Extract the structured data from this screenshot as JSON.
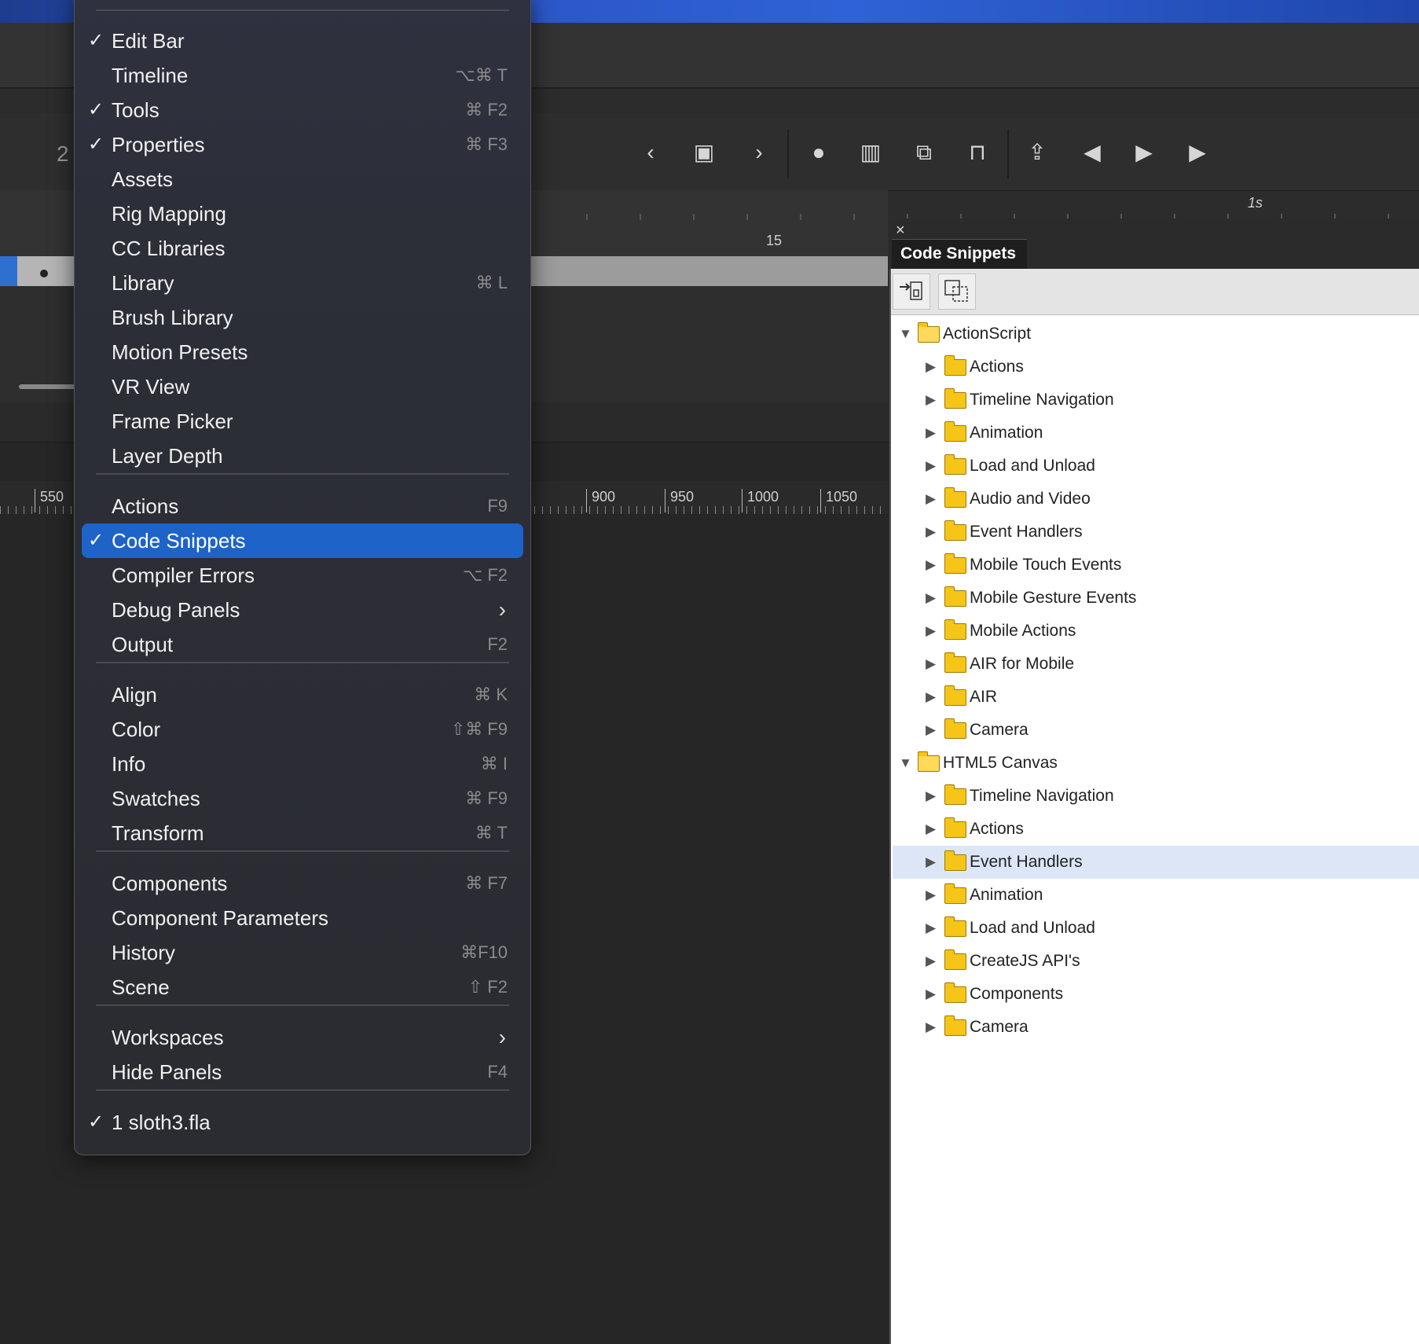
{
  "timeline": {
    "frame_15": "15",
    "time_1s": "1s",
    "layer_num": "2"
  },
  "stage_ruler": [
    "550",
    "900",
    "950",
    "1000",
    "1050"
  ],
  "menu": {
    "items": [
      {
        "label": "Edit Bar",
        "checked": "✓",
        "shortcut": ""
      },
      {
        "label": "Timeline",
        "checked": "",
        "shortcut": "⌥⌘ T"
      },
      {
        "label": "Tools",
        "checked": "✓",
        "shortcut": "⌘ F2"
      },
      {
        "label": "Properties",
        "checked": "✓",
        "shortcut": "⌘ F3"
      },
      {
        "label": "Assets",
        "checked": "",
        "shortcut": ""
      },
      {
        "label": "Rig Mapping",
        "checked": "",
        "shortcut": ""
      },
      {
        "label": "CC Libraries",
        "checked": "",
        "shortcut": ""
      },
      {
        "label": "Library",
        "checked": "",
        "shortcut": "⌘ L"
      },
      {
        "label": "Brush Library",
        "checked": "",
        "shortcut": ""
      },
      {
        "label": "Motion Presets",
        "checked": "",
        "shortcut": ""
      },
      {
        "label": "VR View",
        "checked": "",
        "shortcut": ""
      },
      {
        "label": "Frame Picker",
        "checked": "",
        "shortcut": ""
      },
      {
        "label": "Layer Depth",
        "checked": "",
        "shortcut": ""
      },
      {
        "label": "Actions",
        "checked": "",
        "shortcut": "F9"
      },
      {
        "label": "Code Snippets",
        "checked": "✓",
        "shortcut": ""
      },
      {
        "label": "Compiler Errors",
        "checked": "",
        "shortcut": "⌥ F2"
      },
      {
        "label": "Debug Panels",
        "checked": "",
        "shortcut": ""
      },
      {
        "label": "Output",
        "checked": "",
        "shortcut": "F2"
      },
      {
        "label": "Align",
        "checked": "",
        "shortcut": "⌘ K"
      },
      {
        "label": "Color",
        "checked": "",
        "shortcut": "⇧⌘ F9"
      },
      {
        "label": "Info",
        "checked": "",
        "shortcut": "⌘ I"
      },
      {
        "label": "Swatches",
        "checked": "",
        "shortcut": "⌘ F9"
      },
      {
        "label": "Transform",
        "checked": "",
        "shortcut": "⌘ T"
      },
      {
        "label": "Components",
        "checked": "",
        "shortcut": "⌘ F7"
      },
      {
        "label": "Component Parameters",
        "checked": "",
        "shortcut": ""
      },
      {
        "label": "History",
        "checked": "",
        "shortcut": "⌘F10"
      },
      {
        "label": "Scene",
        "checked": "",
        "shortcut": "⇧ F2"
      },
      {
        "label": "Workspaces",
        "checked": "",
        "shortcut": ""
      },
      {
        "label": "Hide Panels",
        "checked": "",
        "shortcut": "F4"
      },
      {
        "label": "1 sloth3.fla",
        "checked": "✓",
        "shortcut": ""
      }
    ],
    "submenu_arrow": "›"
  },
  "code_snippets": {
    "close": "×",
    "tab_title": "Code Snippets",
    "tree": {
      "actionscript": {
        "label": "ActionScript",
        "children": [
          "Actions",
          "Timeline Navigation",
          "Animation",
          "Load and Unload",
          "Audio and Video",
          "Event Handlers",
          "Mobile Touch Events",
          "Mobile Gesture Events",
          "Mobile Actions",
          "AIR for Mobile",
          "AIR",
          "Camera"
        ]
      },
      "html5": {
        "label": "HTML5 Canvas",
        "children": [
          "Timeline Navigation",
          "Actions",
          "Event Handlers",
          "Animation",
          "Load and Unload",
          "CreateJS API's",
          "Components",
          "Camera"
        ]
      }
    },
    "selected": "Event Handlers"
  },
  "colors": {
    "highlight": "#1d63c8",
    "tree_selected": "#dce6f7",
    "folder": "#f5c518"
  }
}
